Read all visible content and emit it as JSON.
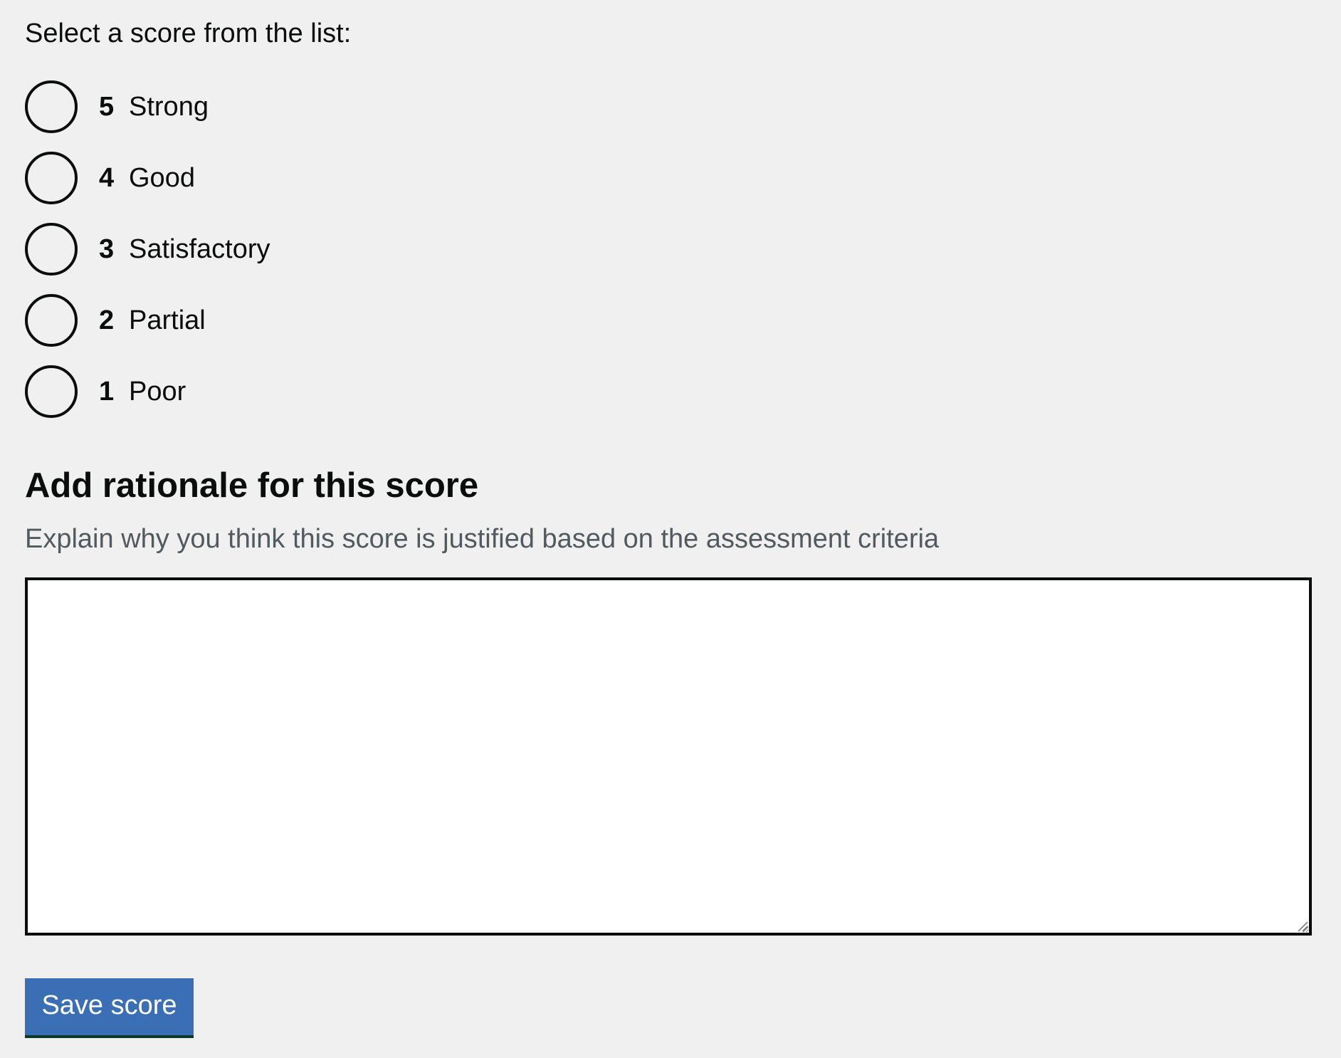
{
  "question": {
    "legend": "Select a score from the list:"
  },
  "scores": [
    {
      "score": "5",
      "label": "Strong"
    },
    {
      "score": "4",
      "label": "Good"
    },
    {
      "score": "3",
      "label": "Satisfactory"
    },
    {
      "score": "2",
      "label": "Partial"
    },
    {
      "score": "1",
      "label": "Poor"
    }
  ],
  "rationale": {
    "heading": "Add rationale for this score",
    "hint": "Explain why you think this score is justified based on the assessment criteria",
    "value": ""
  },
  "actions": {
    "save_label": "Save score"
  },
  "colors": {
    "button_background": "#3a6fb5",
    "page_background": "#f0f0f0",
    "text": "#0b0c0c",
    "hint_text": "#505a5f"
  }
}
